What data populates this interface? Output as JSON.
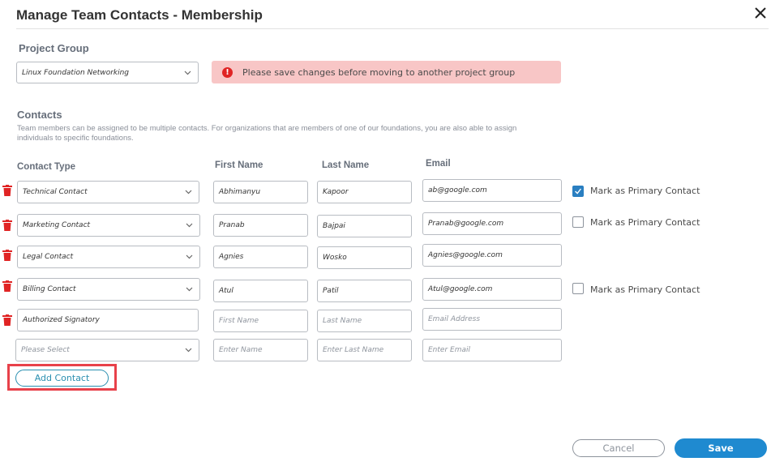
{
  "dialog": {
    "title": "Manage Team Contacts - Membership",
    "close_icon": "close-icon"
  },
  "project_group": {
    "heading": "Project Group",
    "selected": "Linux Foundation Networking",
    "alert_icon": "!",
    "alert_message": "Please save changes before moving to another project group"
  },
  "contacts": {
    "heading": "Contacts",
    "description": "Team members can be assigned to be multiple contacts. For organizations that are members of one of our foundations, you are also able to assign individuals to specific foundations.",
    "columns": {
      "type": "Contact Type",
      "first": "First Name",
      "last": "Last Name",
      "email": "Email"
    },
    "primary_label": "Mark as Primary Contact",
    "rows": [
      {
        "type": "Technical Contact",
        "first": "Abhimanyu",
        "last": "Kapoor",
        "email": "ab@google.com",
        "primary": true
      },
      {
        "type": "Marketing Contact",
        "first": "Pranab",
        "last": "Bajpai",
        "email": "Pranab@google.com",
        "primary": false
      },
      {
        "type": "Legal Contact",
        "first": "Agnies",
        "last": "Wosko",
        "email": "Agnies@google.com"
      },
      {
        "type": "Billing Contact",
        "first": "Atul",
        "last": "Patil",
        "email": "Atul@google.com",
        "primary": false
      },
      {
        "type": "Authorized Signatory",
        "first_placeholder": "First Name",
        "last_placeholder": "Last Name",
        "email_placeholder": "Email Address"
      },
      {
        "type_placeholder": "Please Select",
        "first_placeholder": "Enter Name",
        "last_placeholder": "Enter Last Name",
        "email_placeholder": "Enter Email"
      }
    ]
  },
  "actions": {
    "add_contact": "Add Contact",
    "cancel": "Cancel",
    "save": "Save"
  },
  "colors": {
    "accent": "#1f8ad0",
    "alert_bg": "#f8c6c6",
    "danger": "#e02424",
    "highlight": "#e8414a"
  }
}
